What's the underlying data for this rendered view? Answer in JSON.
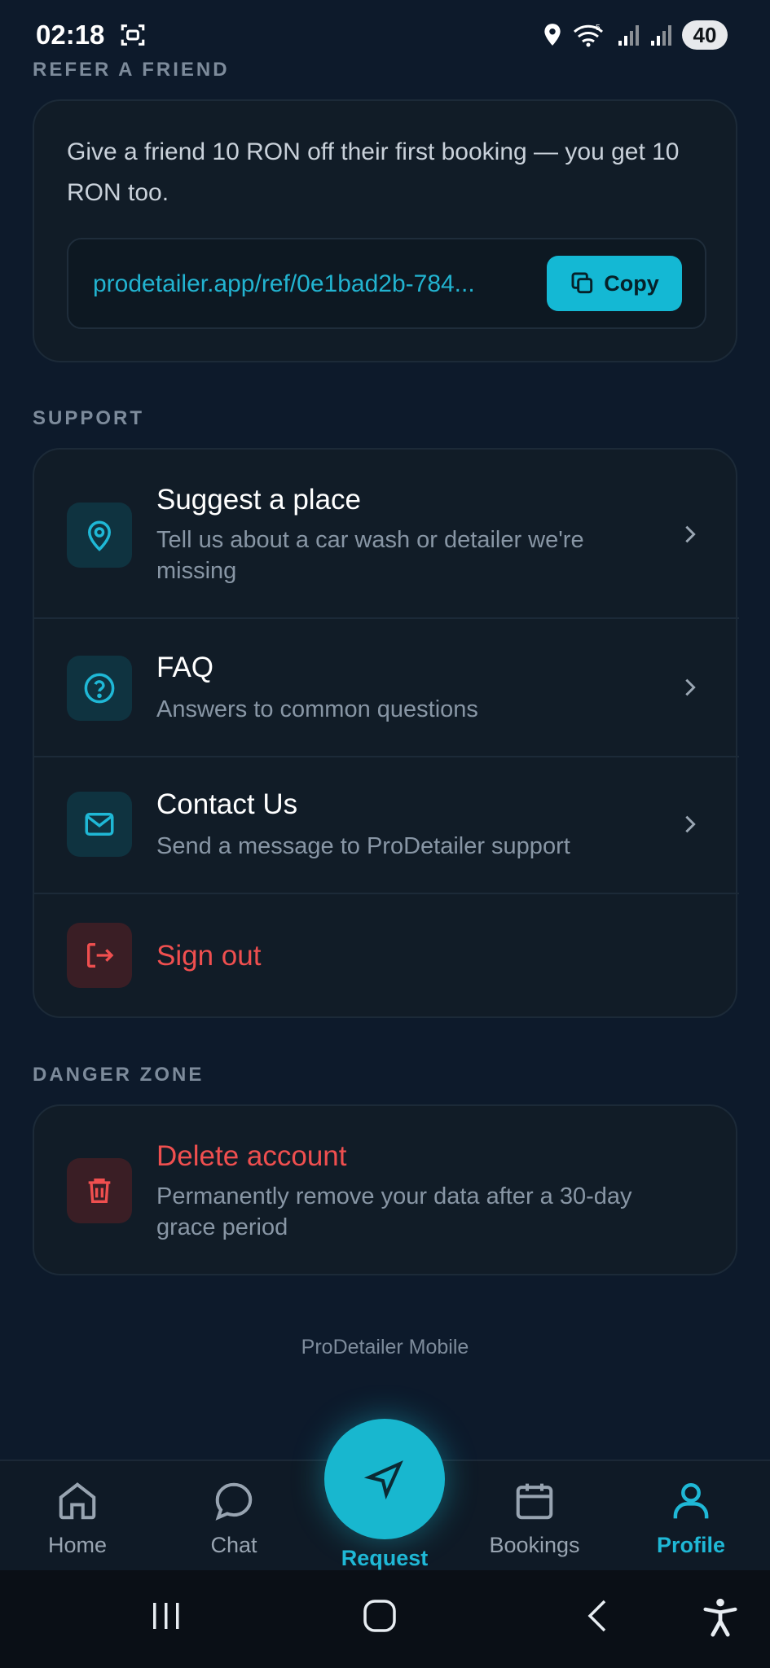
{
  "status_bar": {
    "time": "02:18",
    "battery": "40",
    "icons": [
      "screenshot-icon",
      "location-icon",
      "wifi-icon",
      "signal-icon",
      "signal-icon"
    ]
  },
  "refer": {
    "section_title": "REFER A FRIEND",
    "description": "Give a friend 10 RON off their first booking — you get 10 RON too.",
    "link": "prodetailer.app/ref/0e1bad2b-784...",
    "copy_label": "Copy"
  },
  "support": {
    "section_title": "SUPPORT",
    "items": [
      {
        "title": "Suggest a place",
        "subtitle": "Tell us about a car wash or detailer we're missing",
        "icon": "map-pin-icon"
      },
      {
        "title": "FAQ",
        "subtitle": "Answers to common questions",
        "icon": "question-icon"
      },
      {
        "title": "Contact Us",
        "subtitle": "Send a message to ProDetailer support",
        "icon": "mail-icon"
      },
      {
        "title": "Sign out",
        "icon": "sign-out-icon"
      }
    ]
  },
  "danger": {
    "section_title": "DANGER ZONE",
    "delete_title": "Delete account",
    "delete_subtitle": "Permanently remove your data after a 30-day grace period"
  },
  "footer": "ProDetailer Mobile",
  "nav": {
    "items": [
      {
        "label": "Home",
        "icon": "home-icon"
      },
      {
        "label": "Chat",
        "icon": "chat-icon"
      },
      {
        "label": "Request",
        "icon": "send-icon"
      },
      {
        "label": "Bookings",
        "icon": "calendar-icon"
      },
      {
        "label": "Profile",
        "icon": "user-icon"
      }
    ],
    "active": "Profile"
  },
  "colors": {
    "background": "#0d1a2b",
    "accent": "#14b8d4",
    "danger": "#ef4f4f",
    "card": "#111c27"
  }
}
